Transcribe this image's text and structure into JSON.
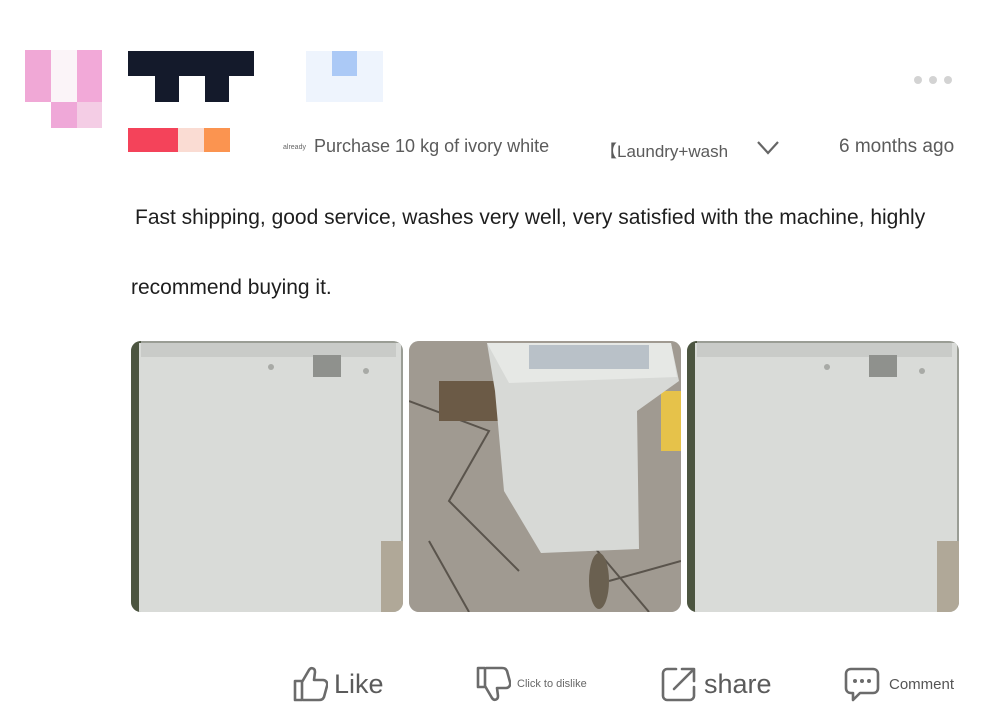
{
  "header": {
    "purchase_prefix": "already",
    "purchase_text": "Purchase 10 kg of ivory white",
    "variant_text": "【Laundry+wash",
    "time_ago": "6 months ago"
  },
  "review": {
    "line1": "Fast shipping, good service, washes very well, very satisfied with the machine, highly",
    "line2": "recommend buying it."
  },
  "photos": [
    {
      "subject": "washing-machine-side"
    },
    {
      "subject": "washing-machine-top-open"
    },
    {
      "subject": "washing-machine-side"
    }
  ],
  "actions": {
    "like": "Like",
    "dislike": "Click to dislike",
    "share": "share",
    "comment": "Comment"
  },
  "icons": {
    "more": "more-dots-icon",
    "expand": "chevron-down-icon",
    "like": "thumbs-up-icon",
    "dislike": "thumbs-down-icon",
    "share": "share-icon",
    "comment": "comment-icon"
  }
}
